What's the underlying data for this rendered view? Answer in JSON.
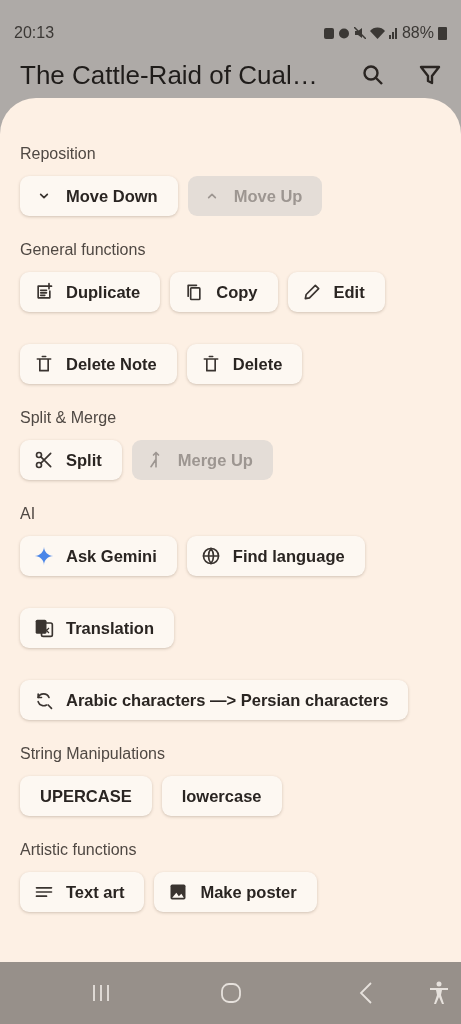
{
  "status_bar": {
    "time": "20:13",
    "battery": "88%"
  },
  "app_bar": {
    "title": "The Cattle-Raid of Cual…"
  },
  "sections": [
    {
      "title": "Reposition",
      "rows": [
        [
          {
            "label": "Move Down",
            "kind": "down",
            "disabled": false
          },
          {
            "label": "Move Up",
            "kind": "up",
            "disabled": true
          }
        ]
      ]
    },
    {
      "title": "General functions",
      "rows": [
        [
          {
            "label": "Duplicate",
            "kind": "duplicate",
            "disabled": false
          },
          {
            "label": "Copy",
            "kind": "copy",
            "disabled": false
          },
          {
            "label": "Edit",
            "kind": "edit",
            "disabled": false
          }
        ],
        [
          {
            "label": "Delete Note",
            "kind": "delete",
            "disabled": false
          },
          {
            "label": "Delete",
            "kind": "delete",
            "disabled": false
          }
        ]
      ]
    },
    {
      "title": "Split & Merge",
      "rows": [
        [
          {
            "label": "Split",
            "kind": "split",
            "disabled": false
          },
          {
            "label": "Merge Up",
            "kind": "merge",
            "disabled": true
          }
        ]
      ]
    },
    {
      "title": "AI",
      "rows": [
        [
          {
            "label": "Ask Gemini",
            "kind": "sparkle",
            "disabled": false
          },
          {
            "label": "Find language",
            "kind": "globe",
            "disabled": false
          }
        ],
        [
          {
            "label": "Translation",
            "kind": "translate",
            "disabled": false
          }
        ],
        [
          {
            "label": "Arabic characters —> Persian characters",
            "kind": "convert",
            "disabled": false
          }
        ]
      ]
    },
    {
      "title": "String Manipulations",
      "rows": [
        [
          {
            "label": "UPERCASE",
            "kind": "plain",
            "disabled": false
          },
          {
            "label": "lowercase",
            "kind": "plain",
            "disabled": false
          }
        ]
      ]
    },
    {
      "title": "Artistic functions",
      "rows": [
        [
          {
            "label": "Text art",
            "kind": "lines",
            "disabled": false
          },
          {
            "label": "Make poster",
            "kind": "image",
            "disabled": false
          }
        ]
      ]
    }
  ]
}
